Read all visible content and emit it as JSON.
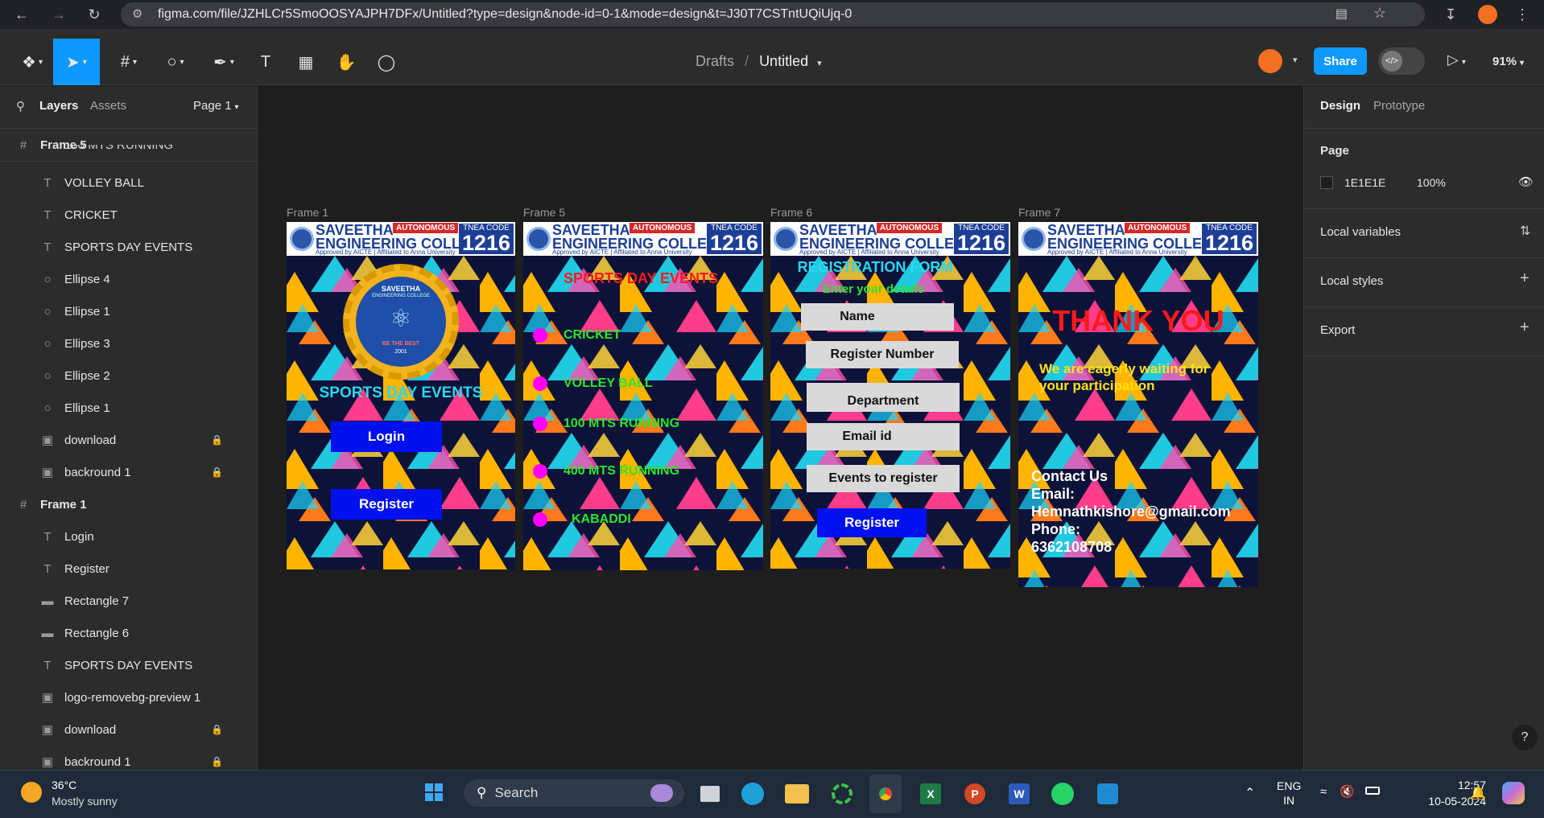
{
  "browser": {
    "url": "figma.com/file/JZHLCr5SmoOOSYAJPH7DFx/Untitled?type=design&node-id=0-1&mode=design&t=J30T7CSTntUQiUjq-0"
  },
  "toolbar": {
    "breadcrumb_parent": "Drafts",
    "breadcrumb_sep": "/",
    "file_name": "Untitled",
    "share_label": "Share",
    "zoom": "91%"
  },
  "left_panel": {
    "tab_layers": "Layers",
    "tab_assets": "Assets",
    "page_select": "Page 1",
    "layers": [
      {
        "label": "Frame 5",
        "type": "frame",
        "top": true
      },
      {
        "label": "100 MTS RUNNING",
        "type": "text"
      },
      {
        "label": "VOLLEY BALL",
        "type": "text"
      },
      {
        "label": "CRICKET",
        "type": "text"
      },
      {
        "label": "SPORTS DAY EVENTS",
        "type": "text"
      },
      {
        "label": "Ellipse 4",
        "type": "ellipse"
      },
      {
        "label": "Ellipse 1",
        "type": "ellipse"
      },
      {
        "label": "Ellipse 3",
        "type": "ellipse"
      },
      {
        "label": "Ellipse 2",
        "type": "ellipse"
      },
      {
        "label": "Ellipse 1",
        "type": "ellipse"
      },
      {
        "label": "download",
        "type": "image",
        "locked": true
      },
      {
        "label": "backround 1",
        "type": "image",
        "locked": true
      },
      {
        "label": "Frame 1",
        "type": "frame",
        "top": true
      },
      {
        "label": "Login",
        "type": "text"
      },
      {
        "label": "Register",
        "type": "text"
      },
      {
        "label": "Rectangle 7",
        "type": "rect"
      },
      {
        "label": "Rectangle 6",
        "type": "rect"
      },
      {
        "label": "SPORTS DAY EVENTS",
        "type": "text"
      },
      {
        "label": "logo-removebg-preview 1",
        "type": "image"
      },
      {
        "label": "download",
        "type": "image",
        "locked": true
      },
      {
        "label": "backround 1",
        "type": "image",
        "locked": true
      }
    ]
  },
  "right_panel": {
    "tab_design": "Design",
    "tab_prototype": "Prototype",
    "page_heading": "Page",
    "page_color": "1E1E1E",
    "page_opacity": "100%",
    "local_variables": "Local variables",
    "local_styles": "Local styles",
    "export": "Export",
    "help": "?"
  },
  "header_card": {
    "name_line1": "SAVEETHA",
    "name_line2": "ENGINEERING COLLEGE",
    "approved": "Approved by AICTE | Affiliated to Anna University",
    "autonomous": "AUTONOMOUS",
    "code_label": "TNEA CODE",
    "code_value": "1216"
  },
  "frames": {
    "f1": {
      "label": "Frame 1",
      "logo_top": "SAVEETHA",
      "logo_sub": "ENGINEERING COLLEGE",
      "logo_motto": "BE THE BEST",
      "logo_year": "2001",
      "title": "SPORTS DAY EVENTS",
      "login": "Login",
      "register": "Register"
    },
    "f5": {
      "label": "Frame 5",
      "title": "SPORTS DAY EVENTS",
      "events": [
        "CRICKET",
        "VOLLEY BALL",
        "100 MTS RUNNING",
        "400 MTS RUNNING",
        "KABADDI"
      ]
    },
    "f6": {
      "label": "Frame 6",
      "title": "REGISTRATION FORM",
      "subtitle": "Enter your details",
      "fields": [
        "Name",
        "Register Number",
        "Department",
        "Email id",
        "Events to register"
      ],
      "register": "Register"
    },
    "f7": {
      "label": "Frame 7",
      "title": "THANK YOU",
      "message": "We are eagerly waiting for your participation",
      "contact_heading": "Contact Us",
      "email_label": "Email:",
      "email": "Hemnathkishore@gmail.com",
      "phone_label": "Phone:",
      "phone": "6362108708"
    }
  },
  "taskbar": {
    "temp": "36°C",
    "weather": "Mostly sunny",
    "search": "Search",
    "lang1": "ENG",
    "lang2": "IN",
    "time": "12:57",
    "date": "10-05-2024"
  }
}
